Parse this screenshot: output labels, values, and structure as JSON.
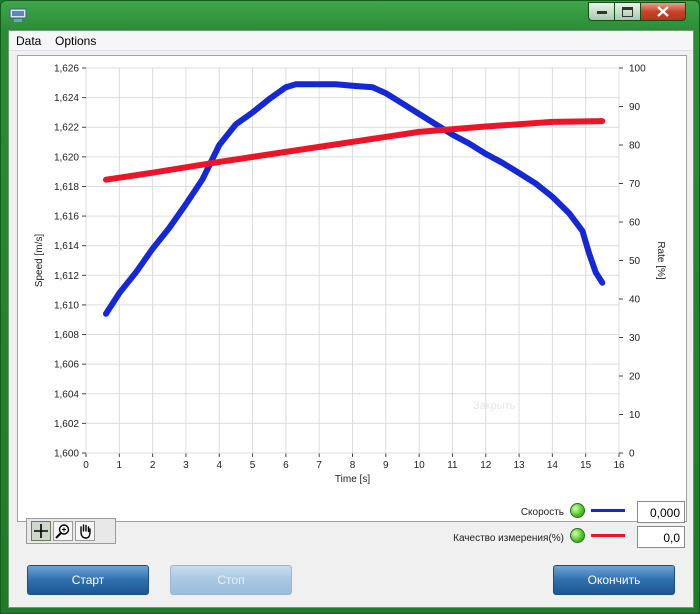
{
  "window": {
    "title": ""
  },
  "menu": {
    "items": [
      "Data",
      "Options"
    ]
  },
  "chart_data": {
    "type": "line",
    "xlabel": "Time [s]",
    "ylabel": "Speed [m/s]",
    "y2label": "Rate [%]",
    "xlim": [
      0,
      16
    ],
    "ylim": [
      1.6,
      1.626
    ],
    "y2lim": [
      0,
      100
    ],
    "x_ticks": [
      "0",
      "1",
      "2",
      "3",
      "4",
      "5",
      "6",
      "7",
      "8",
      "9",
      "10",
      "11",
      "12",
      "13",
      "14",
      "15",
      "16"
    ],
    "y_ticks": [
      "1,600",
      "1,602",
      "1,604",
      "1,606",
      "1,608",
      "1,610",
      "1,612",
      "1,614",
      "1,616",
      "1,618",
      "1,620",
      "1,622",
      "1,624",
      "1,626"
    ],
    "y2_ticks": [
      "0",
      "10",
      "20",
      "30",
      "40",
      "50",
      "60",
      "70",
      "80",
      "90",
      "100"
    ],
    "grid": true,
    "series": [
      {
        "name": "Скорость",
        "axis": "left",
        "color": "#1428d8",
        "x": [
          0.6,
          1.0,
          1.5,
          2.0,
          2.5,
          3.0,
          3.5,
          4.0,
          4.5,
          5.0,
          5.5,
          6.0,
          6.3,
          7.0,
          7.5,
          8.0,
          8.6,
          9.0,
          9.5,
          10.0,
          10.5,
          11.0,
          11.5,
          12.0,
          12.5,
          13.0,
          13.5,
          14.0,
          14.5,
          14.9,
          15.1,
          15.3,
          15.5
        ],
        "y": [
          1.6094,
          1.6108,
          1.6122,
          1.6138,
          1.6152,
          1.6168,
          1.6185,
          1.6208,
          1.6222,
          1.623,
          1.6239,
          1.6247,
          1.6249,
          1.6249,
          1.6249,
          1.6248,
          1.6247,
          1.6243,
          1.6236,
          1.6229,
          1.6222,
          1.6215,
          1.6209,
          1.6202,
          1.6196,
          1.6189,
          1.6182,
          1.6173,
          1.6162,
          1.615,
          1.6135,
          1.6122,
          1.6115
        ]
      },
      {
        "name": "Качество измерения(%)",
        "axis": "right",
        "color": "#ee1428",
        "x": [
          0.6,
          2.0,
          4.0,
          6.0,
          8.0,
          10.0,
          12.0,
          14.0,
          15.5
        ],
        "y": [
          71.0,
          72.8,
          75.6,
          78.2,
          80.8,
          83.4,
          84.8,
          86.0,
          86.2
        ]
      }
    ]
  },
  "watermark": "Закрыть",
  "legend": {
    "speed_label": "Скорость",
    "speed_value": "0,000",
    "speed_color": "#1428d8",
    "quality_label": "Качество измерения(%)",
    "quality_value": "0,0",
    "quality_color": "#ee1428"
  },
  "toolbar_icons": [
    "crosshair-icon",
    "zoom-icon",
    "pan-hand-icon"
  ],
  "buttons": {
    "start": "Старт",
    "stop": "Стоп",
    "finish": "Окончить"
  }
}
